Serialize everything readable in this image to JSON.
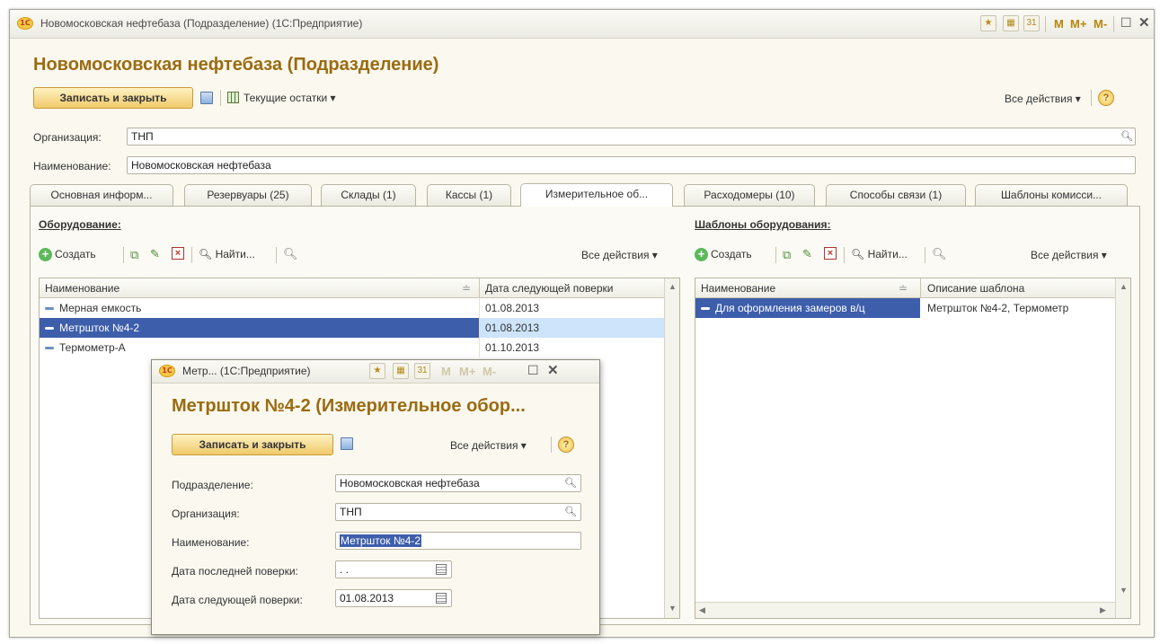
{
  "window": {
    "title": "Новомосковская нефтебаза (Подразделение) (1С:Предприятие)",
    "logo": "1С",
    "controls": [
      "M",
      "M+",
      "M-"
    ]
  },
  "form": {
    "heading": "Новомосковская нефтебаза (Подразделение)",
    "save_close": "Записать и закрыть",
    "current_balances": "Текущие остатки",
    "all_actions": "Все действия",
    "org_label": "Организация:",
    "org_value": "ТНП",
    "name_label": "Наименование:",
    "name_value": "Новомосковская нефтебаза"
  },
  "tabs": [
    {
      "label": "Основная информ..."
    },
    {
      "label": "Резервуары (25)"
    },
    {
      "label": "Склады (1)"
    },
    {
      "label": "Кассы (1)"
    },
    {
      "label": "Измерительное об..."
    },
    {
      "label": "Расходомеры (10)"
    },
    {
      "label": "Способы связи (1)"
    },
    {
      "label": "Шаблоны комисси..."
    }
  ],
  "equipment": {
    "header": "Оборудование:",
    "create": "Создать",
    "find": "Найти...",
    "all_actions": "Все действия",
    "columns": [
      "Наименование",
      "Дата следующей поверки"
    ],
    "rows": [
      {
        "name": "Мерная емкость",
        "date": "01.08.2013"
      },
      {
        "name": "Метршток №4-2",
        "date": "01.08.2013"
      },
      {
        "name": "Термометр-А",
        "date": "01.10.2013"
      }
    ]
  },
  "templates": {
    "header": "Шаблоны оборудования:",
    "create": "Создать",
    "find": "Найти...",
    "all_actions": "Все действия",
    "columns": [
      "Наименование",
      "Описание шаблона"
    ],
    "rows": [
      {
        "name": "Для оформления замеров в/ц",
        "desc": "Метршток №4-2, Термометр"
      }
    ]
  },
  "popup": {
    "title": "Метр... (1С:Предприятие)",
    "heading": "Метршток №4-2 (Измерительное обор...",
    "save_close": "Записать и закрыть",
    "all_actions": "Все действия",
    "fields": {
      "division_label": "Подразделение:",
      "division_value": "Новомосковская нефтебаза",
      "org_label": "Организация:",
      "org_value": "ТНП",
      "name_label": "Наименование:",
      "name_value": "Метршток №4-2",
      "last_check_label": "Дата последней поверки:",
      "last_check_value": " . .",
      "next_check_label": "Дата следующей поверки:",
      "next_check_value": "01.08.2013"
    }
  }
}
